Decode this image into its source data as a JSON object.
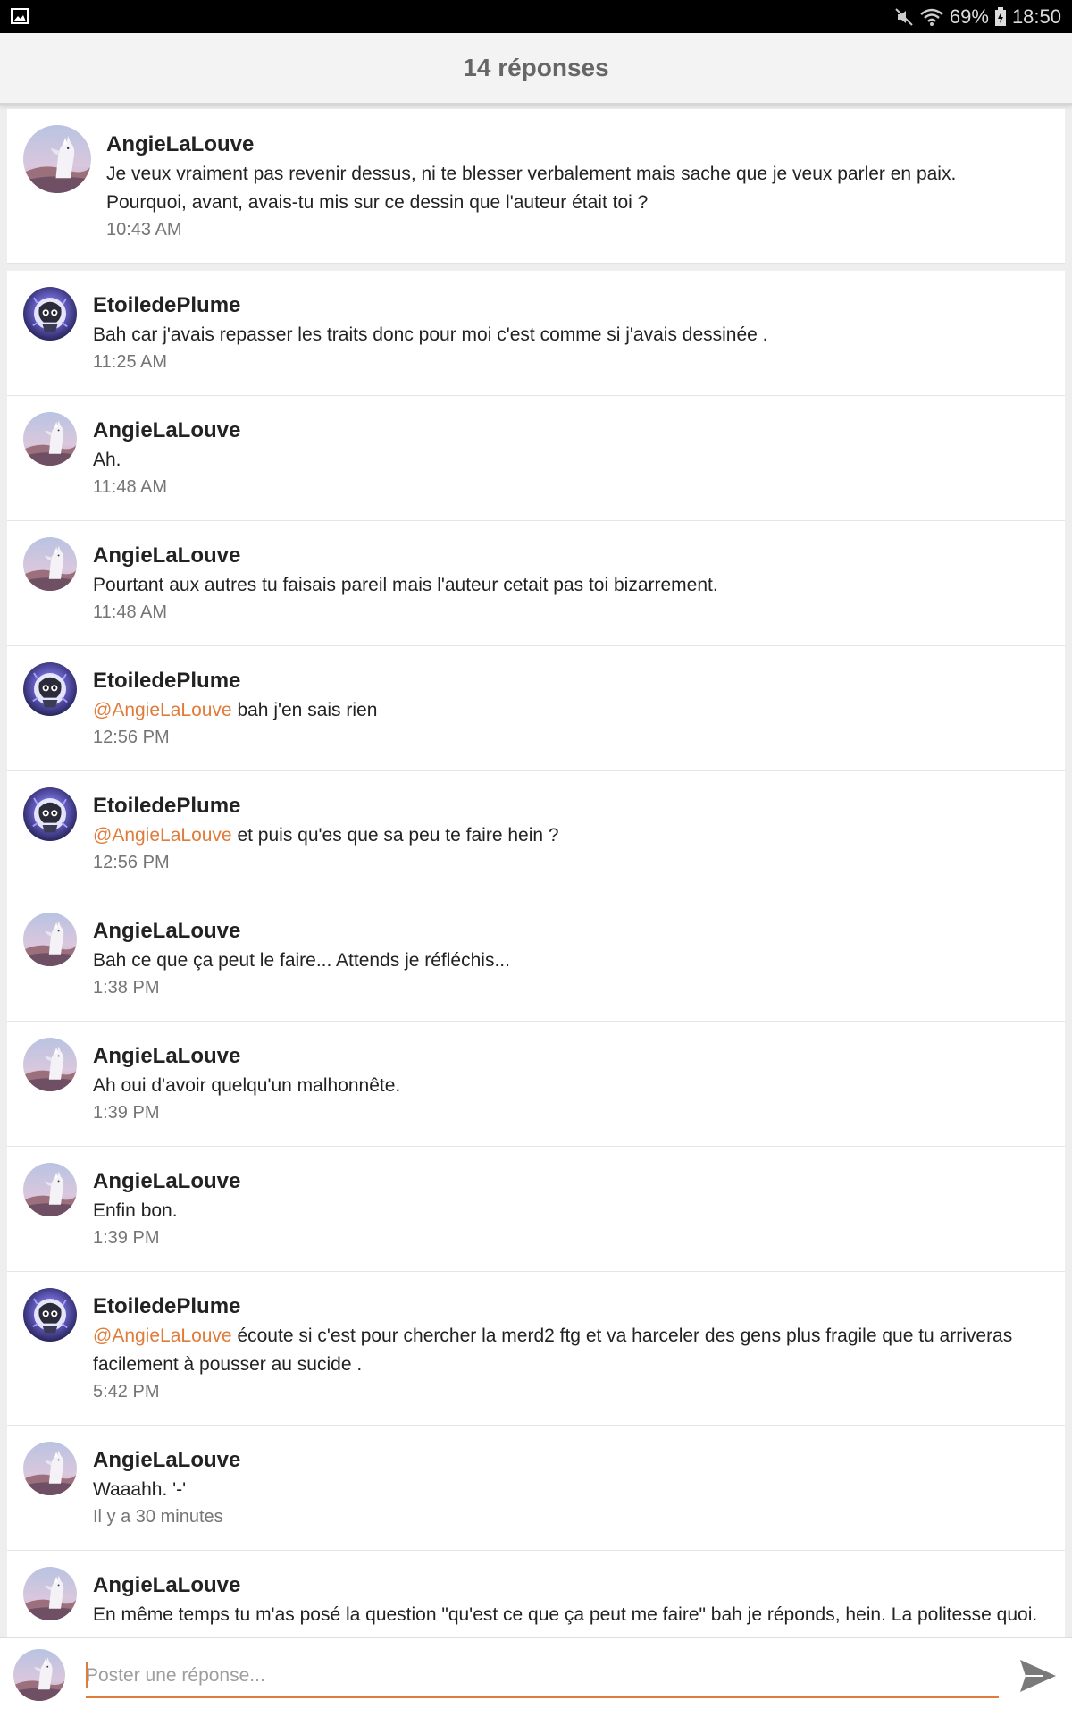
{
  "status_bar": {
    "battery": "69%",
    "time": "18:50",
    "icons": [
      "gallery-icon",
      "mute-icon",
      "wifi-icon",
      "battery-icon"
    ]
  },
  "header": {
    "title": "14 réponses"
  },
  "original_post": {
    "author": "AngieLaLouve",
    "message": "Je veux vraiment pas revenir dessus, ni te blesser verbalement mais sache que je veux parler en paix. Pourquoi, avant, avais-tu mis sur ce dessin que l'auteur était toi ?",
    "time": "10:43 AM"
  },
  "replies": [
    {
      "author": "EtoiledePlume",
      "mention": "",
      "message": "Bah car j'avais repasser les traits donc pour moi c'est comme si j'avais dessinée .",
      "time": "11:25 AM"
    },
    {
      "author": "AngieLaLouve",
      "mention": "",
      "message": "Ah.",
      "time": "11:48 AM"
    },
    {
      "author": "AngieLaLouve",
      "mention": "",
      "message": "Pourtant aux autres tu faisais pareil mais l'auteur cetait pas toi bizarrement.",
      "time": "11:48 AM"
    },
    {
      "author": "EtoiledePlume",
      "mention": "@AngieLaLouve",
      "message": "bah j'en sais rien",
      "time": "12:56 PM"
    },
    {
      "author": "EtoiledePlume",
      "mention": "@AngieLaLouve",
      "message": "et puis qu'es que sa peu te faire hein ?",
      "time": "12:56 PM"
    },
    {
      "author": "AngieLaLouve",
      "mention": "",
      "message": "Bah ce que ça peut le faire... Attends je réfléchis...",
      "time": "1:38 PM"
    },
    {
      "author": "AngieLaLouve",
      "mention": "",
      "message": "Ah oui d'avoir quelqu'un malhonnête.",
      "time": "1:39 PM"
    },
    {
      "author": "AngieLaLouve",
      "mention": "",
      "message": "Enfin bon.",
      "time": "1:39 PM"
    },
    {
      "author": "EtoiledePlume",
      "mention": "@AngieLaLouve",
      "message": "écoute si c'est pour chercher la merd2 ftg et va harceler des gens plus fragile que tu arriveras facilement à pousser au sucide .",
      "time": "5:42 PM"
    },
    {
      "author": "AngieLaLouve",
      "mention": "",
      "message": "Waaahh. '-'",
      "time": "Il y a 30 minutes"
    },
    {
      "author": "AngieLaLouve",
      "mention": "",
      "message": "En même temps tu m'as posé la question \"qu'est ce que ça peut me faire\" bah je réponds, hein. La politesse quoi.",
      "time": ""
    }
  ],
  "composer": {
    "placeholder": "Poster une réponse...",
    "value": "",
    "send_icon": "send-icon"
  },
  "colors": {
    "accent": "#e07b39",
    "status_bar": "#000000",
    "header_bg": "#f3f3f3",
    "title": "#666666",
    "time": "#757575"
  }
}
